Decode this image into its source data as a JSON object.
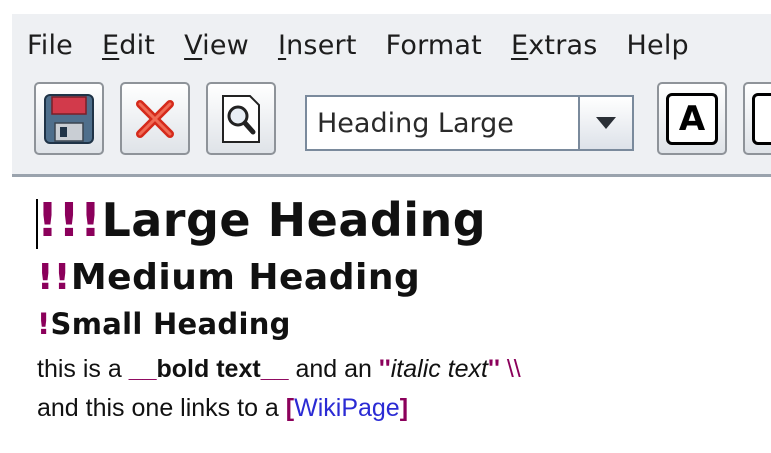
{
  "menu": {
    "items": [
      {
        "label": "File",
        "mnemonic": ""
      },
      {
        "label": "Edit",
        "mnemonic": "E"
      },
      {
        "label": "View",
        "mnemonic": "V"
      },
      {
        "label": "Insert",
        "mnemonic": "I"
      },
      {
        "label": "Format",
        "mnemonic": ""
      },
      {
        "label": "Extras",
        "mnemonic": "E"
      },
      {
        "label": "Help",
        "mnemonic": ""
      }
    ]
  },
  "toolbar": {
    "icons": [
      "floppy-disk-icon",
      "red-x-icon",
      "magnifier-icon",
      "bold-a-icon"
    ],
    "style_select": {
      "value": "Heading Large"
    },
    "bold_letter": "A"
  },
  "editor": {
    "line1": {
      "markup": "!!!",
      "text": "Large Heading"
    },
    "line2": {
      "markup": "!!",
      "text": "Medium Heading"
    },
    "line3": {
      "markup": "!",
      "text": "Small Heading"
    },
    "line4": {
      "prefix": "this is a ",
      "bold_open": "__",
      "bold_text": "bold text",
      "bold_close": "__",
      "middle": " and an ",
      "italic_open": "''",
      "italic_text": "italic text",
      "italic_close": "''",
      "line_break": " \\\\"
    },
    "line5": {
      "prefix": "and this one links to a ",
      "link_open": "[",
      "link_text": "WikiPage",
      "link_close": "]"
    }
  },
  "colors": {
    "markup": "#8b005b",
    "link": "#2b2bd4",
    "window_bg": "#eef0f3"
  }
}
